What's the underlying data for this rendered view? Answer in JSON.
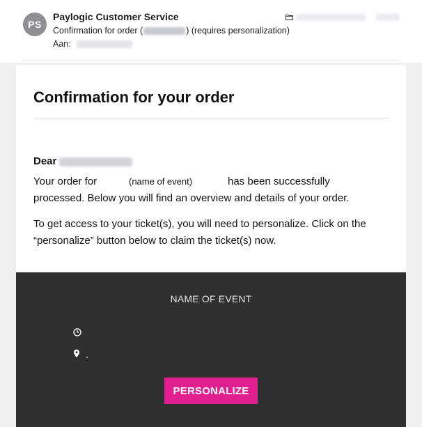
{
  "header": {
    "avatar_initials": "PS",
    "sender": "Paylogic Customer Service",
    "subject_prefix": "Confirmation for order (",
    "subject_suffix": ") (requires personalization)",
    "to_label": "Aan:"
  },
  "email": {
    "title": "Confirmation for your order",
    "dear": "Dear",
    "order_prefix": "Your order for",
    "event_placeholder": "(name of event)",
    "order_suffix": "has been successfully",
    "processed": "processed. Below you will find an overview and details of your order.",
    "personalize_line_1": "To get access to your ticket(s), you will need to personalize. Click on the",
    "personalize_line_2": "“personalize” button below to claim the ticket(s) now."
  },
  "event_panel": {
    "event_name": "NAME OF EVENT",
    "button_label": "PERSONALIZE"
  },
  "colors": {
    "accent": "#e21f8f",
    "panel": "#2f2f2f",
    "avatar": "#8e8e93"
  },
  "icons": [
    "folder-icon",
    "clock-icon",
    "map-pin-icon"
  ]
}
